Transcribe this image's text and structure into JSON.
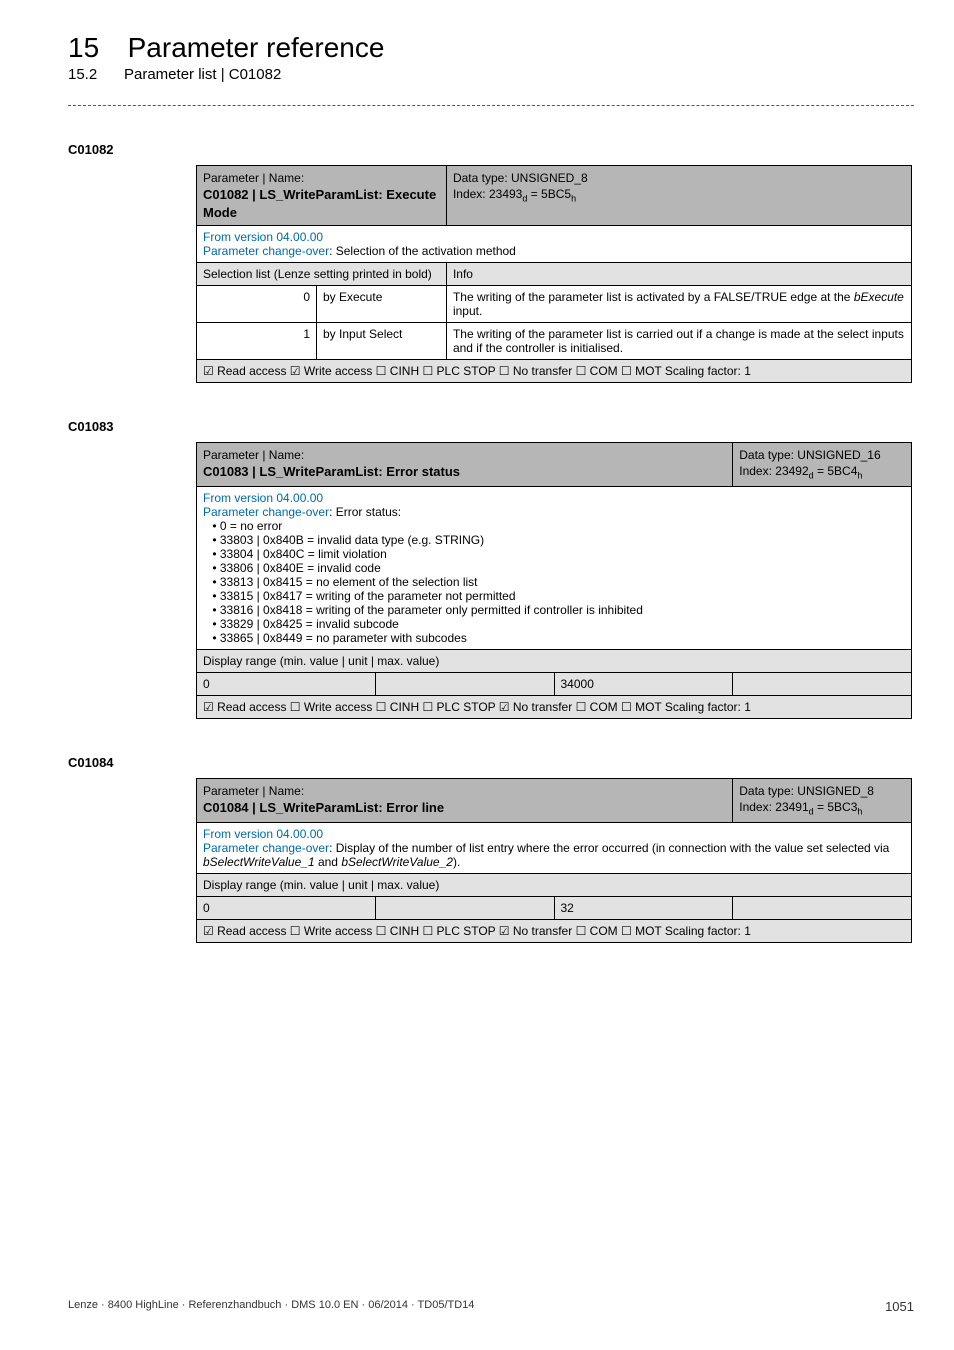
{
  "header": {
    "chapter_num": "15",
    "chapter_title": "Parameter reference",
    "sub_num": "15.2",
    "sub_title": "Parameter list | C01082"
  },
  "t1": {
    "id": "C01082",
    "pn_label": "Parameter | Name:",
    "pname": "C01082 | LS_WriteParamList: Execute Mode",
    "dtype1": "Data type: UNSIGNED_8",
    "dtype2_pre": "Index: 23493",
    "dtype2_sub1": "d",
    "dtype2_mid": " = 5BC5",
    "dtype2_sub2": "h",
    "from": "From version 04.00.00",
    "pco_link": "Parameter change-over",
    "pco_rest": ": Selection of the activation method",
    "sel_hdr": "Selection list (Lenze setting printed in bold)",
    "info_hdr": "Info",
    "r1n": "0",
    "r1v": "by Execute",
    "r1i_a": "The writing of the parameter list is activated by a FALSE/TRUE edge at the ",
    "r1i_b": "bExecute",
    "r1i_c": " input.",
    "r2n": "1",
    "r2v": "by Input Select",
    "r2i": "The writing of the parameter list is carried out if a change is made at the select inputs and if the controller is initialised.",
    "footer": "☑ Read access   ☑ Write access   ☐ CINH   ☐ PLC STOP   ☐ No transfer   ☐ COM   ☐ MOT      Scaling factor: 1"
  },
  "t2": {
    "id": "C01083",
    "pn_label": "Parameter | Name:",
    "pname": "C01083 | LS_WriteParamList: Error status",
    "dtype1": "Data type: UNSIGNED_16",
    "dtype2_pre": "Index: 23492",
    "dtype2_sub1": "d",
    "dtype2_mid": " = 5BC4",
    "dtype2_sub2": "h",
    "from": "From version 04.00.00",
    "pco_link": "Parameter change-over",
    "pco_rest": ": Error status:",
    "bullets": [
      "0 = no error",
      "33803 | 0x840B = invalid data type (e.g. STRING)",
      "33804 | 0x840C = limit violation",
      "33806 | 0x840E = invalid code",
      "33813 | 0x8415 = no element of the selection list",
      "33815 | 0x8417 = writing of the parameter not permitted",
      "33816 | 0x8418 = writing of the parameter only permitted if controller is inhibited",
      "33829 | 0x8425 = invalid subcode",
      "33865 | 0x8449 = no parameter with subcodes"
    ],
    "disp_hdr": "Display range (min. value | unit | max. value)",
    "min": "0",
    "max": "34000",
    "footer": "☑ Read access   ☐ Write access   ☐ CINH   ☐ PLC STOP   ☑ No transfer   ☐ COM   ☐ MOT      Scaling factor: 1"
  },
  "t3": {
    "id": "C01084",
    "pn_label": "Parameter | Name:",
    "pname": "C01084 | LS_WriteParamList: Error line",
    "dtype1": "Data type: UNSIGNED_8",
    "dtype2_pre": "Index: 23491",
    "dtype2_sub1": "d",
    "dtype2_mid": " = 5BC3",
    "dtype2_sub2": "h",
    "from": "From version 04.00.00",
    "pco_link": "Parameter change-over",
    "pco_rest_a": ": Display of the number of list entry where the error occurred (in connection with the value set selected via ",
    "pco_rest_b": "bSelectWriteValue_1",
    "pco_rest_c": " and ",
    "pco_rest_d": "bSelectWriteValue_2",
    "pco_rest_e": ").",
    "disp_hdr": "Display range (min. value | unit | max. value)",
    "min": "0",
    "max": "32",
    "footer": "☑ Read access   ☐ Write access   ☐ CINH   ☐ PLC STOP   ☑ No transfer   ☐ COM   ☐ MOT      Scaling factor: 1"
  },
  "footer": {
    "left": "Lenze · 8400 HighLine · Referenzhandbuch · DMS 10.0 EN · 06/2014 · TD05/TD14",
    "page": "1051"
  }
}
